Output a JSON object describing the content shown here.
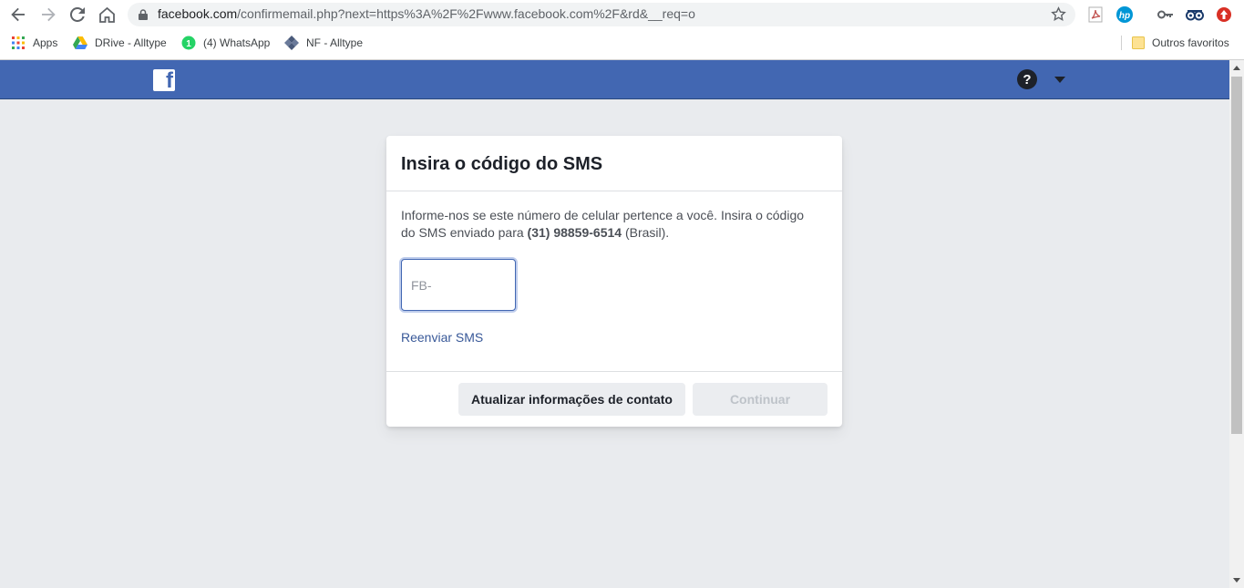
{
  "browser": {
    "url_host": "facebook.com",
    "url_rest": "/confirmemail.php?next=https%3A%2F%2Fwww.facebook.com%2F&rd&__req=o",
    "bookmarks": [
      {
        "label": "Apps",
        "icon": "apps-grid-icon"
      },
      {
        "label": "DRive - Alltype",
        "icon": "google-drive-icon"
      },
      {
        "label": "(4) WhatsApp",
        "icon": "whatsapp-icon"
      },
      {
        "label": "NF - Alltype",
        "icon": "nf-diamond-icon"
      }
    ],
    "other_bookmarks": "Outros favoritos",
    "extensions": [
      "pdf-icon",
      "hp-icon",
      "key-icon",
      "tripadvisor-icon",
      "stop-icon"
    ]
  },
  "fbbar": {
    "logo_letter": "f",
    "help_symbol": "?"
  },
  "card": {
    "title": "Insira o código do SMS",
    "description_prefix": "Informe-nos se este número de celular pertence a você. Insira o código do SMS enviado para ",
    "phone": "(31) 98859-6514",
    "description_suffix": " (Brasil).",
    "code_input": {
      "value": "",
      "placeholder": "FB-"
    },
    "resend_link": "Reenviar SMS",
    "update_button": "Atualizar informações de contato",
    "continue_button": "Continuar"
  },
  "colors": {
    "facebook_blue": "#4267b2",
    "page_background": "#e9ebee",
    "link": "#385898"
  }
}
